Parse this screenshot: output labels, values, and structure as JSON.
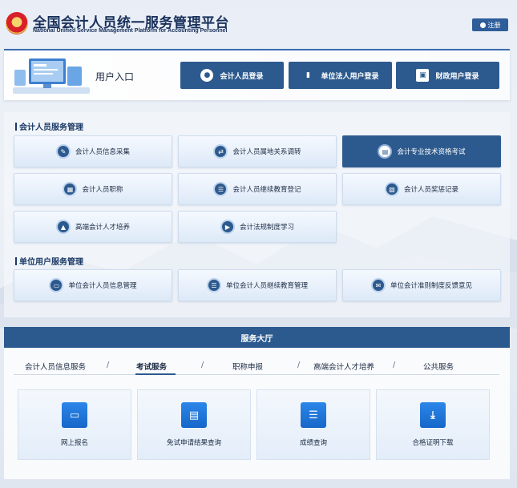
{
  "header": {
    "title_cn": "全国会计人员统一服务管理平台",
    "title_en": "National Unified Service Management Platform for Accounting Personnel",
    "register_label": "注册"
  },
  "login": {
    "title": "用户入口",
    "buttons": [
      {
        "label": "会计人员登录",
        "icon": "user-icon"
      },
      {
        "label": "单位法人用户登录",
        "icon": "building-chart-icon"
      },
      {
        "label": "财政用户登录",
        "icon": "monitor-icon"
      }
    ]
  },
  "sections": {
    "accountant": {
      "title": "会计人员服务管理",
      "items": [
        {
          "label": "会计人员信息采集",
          "icon": "document-edit-icon"
        },
        {
          "label": "会计人员属地关系调转",
          "icon": "user-transfer-icon"
        },
        {
          "label": "会计专业技术资格考试",
          "icon": "printer-icon"
        },
        {
          "label": "会计人员职称",
          "icon": "certificate-icon"
        },
        {
          "label": "会计人员继续教育登记",
          "icon": "form-icon"
        },
        {
          "label": "会计人员奖惩记录",
          "icon": "record-icon"
        },
        {
          "label": "高端会计人才培养",
          "icon": "graduation-cap-icon"
        },
        {
          "label": "会计法规制度学习",
          "icon": "play-icon"
        }
      ]
    },
    "unit": {
      "title": "单位用户服务管理",
      "items": [
        {
          "label": "单位会计人员信息管理",
          "icon": "card-icon"
        },
        {
          "label": "单位会计人员继续教育管理",
          "icon": "form-icon"
        },
        {
          "label": "单位会计准则制度反馈意见",
          "icon": "feedback-icon"
        }
      ]
    }
  },
  "hall": {
    "title": "服务大厅",
    "tabs": [
      "会计人员信息服务",
      "考试服务",
      "职称申报",
      "高端会计人才培养",
      "公共服务"
    ],
    "separator": "/",
    "active_tab": "考试服务",
    "cards": [
      {
        "label": "网上报名",
        "icon": "card-icon"
      },
      {
        "label": "免试申请结果查询",
        "icon": "printer-icon"
      },
      {
        "label": "成绩查询",
        "icon": "document-icon"
      },
      {
        "label": "合格证明下载",
        "icon": "download-icon"
      }
    ]
  },
  "colors": {
    "primary": "#2d5a8e",
    "icon_blue": "#1667c9",
    "title": "#18305a"
  }
}
